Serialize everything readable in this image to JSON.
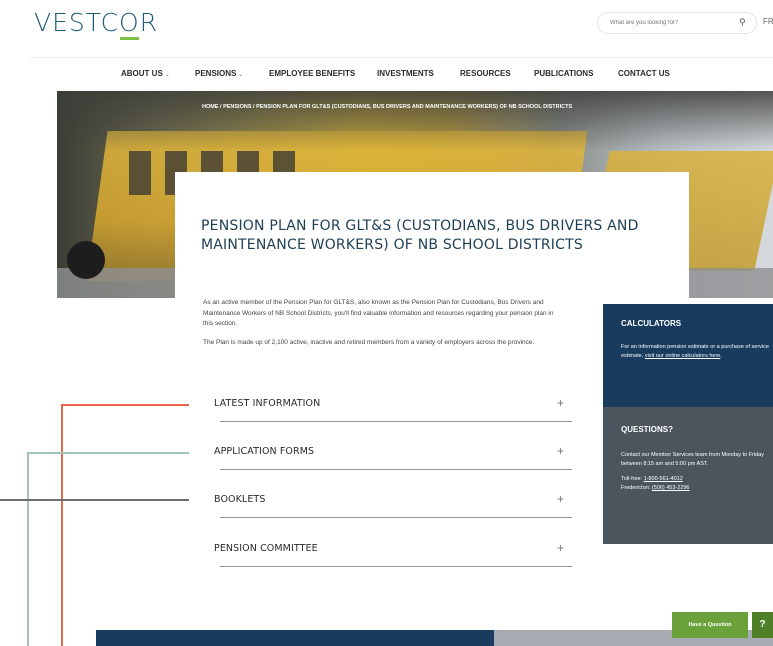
{
  "header": {
    "logo": {
      "pre": "VESTC",
      "o": "O",
      "post": "R"
    },
    "search_placeholder": "What are you looking for?",
    "search_icon": "magnifier-icon",
    "lang": "FR"
  },
  "nav": {
    "items": [
      {
        "label": "ABOUT US",
        "caret": "⌄"
      },
      {
        "label": "PENSIONS",
        "caret": "⌄"
      },
      {
        "label": "EMPLOYEE BENEFITS"
      },
      {
        "label": "INVESTMENTS"
      },
      {
        "label": "RESOURCES"
      },
      {
        "label": "PUBLICATIONS"
      },
      {
        "label": "CONTACT US"
      }
    ]
  },
  "breadcrumb": "HOME / PENSIONS / PENSION PLAN FOR GLT&S (CUSTODIANS, BUS DRIVERS AND MAINTENANCE WORKERS) OF NB SCHOOL DISTRICTS",
  "page_title": "PENSION PLAN FOR GLT&S (CUSTODIANS, BUS DRIVERS AND MAINTENANCE WORKERS) OF NB SCHOOL DISTRICTS",
  "intro": {
    "p1": "As an active member of the Pension Plan for GLT&S, also known as the Pension Plan for Custodians, Bus Drivers and Maintenance Workers of NB School Districts, you'll find valuable information and resources regarding your pension plan in this section.",
    "p2": "The Plan  is made up of 2,100 active, inactive and retired members from a variety of employers across the province."
  },
  "accordion": [
    {
      "label": "LATEST INFORMATION",
      "icon": "+"
    },
    {
      "label": "APPLICATION FORMS",
      "icon": "+"
    },
    {
      "label": "BOOKLETS",
      "icon": "+"
    },
    {
      "label": "PENSION COMMITTEE",
      "icon": "+"
    }
  ],
  "calculators": {
    "title": "CALCULATORS",
    "text": "For an information pension estimate or a purchase of service estimate, ",
    "link": "visit our online calculators here",
    "end": "."
  },
  "questions": {
    "title": "QUESTIONS?",
    "text": "Contact our Member Services team from Monday to Friday between 8:15 am and 5:00 pm AST.",
    "tollfree_label": "Toll-free: ",
    "tollfree": "1-800-561-4012",
    "fredericton_label": "Fredericton: ",
    "fredericton": "(506) 453-2296"
  },
  "help": {
    "label": "Have a Question",
    "icon": "?"
  },
  "colors": {
    "navy": "#183b5e",
    "slate": "#4a555e",
    "green": "#6aa13a",
    "accent_red": "#e8674c",
    "accent_teal": "#9fc3b4",
    "accent_grey": "#6f6f6f"
  }
}
